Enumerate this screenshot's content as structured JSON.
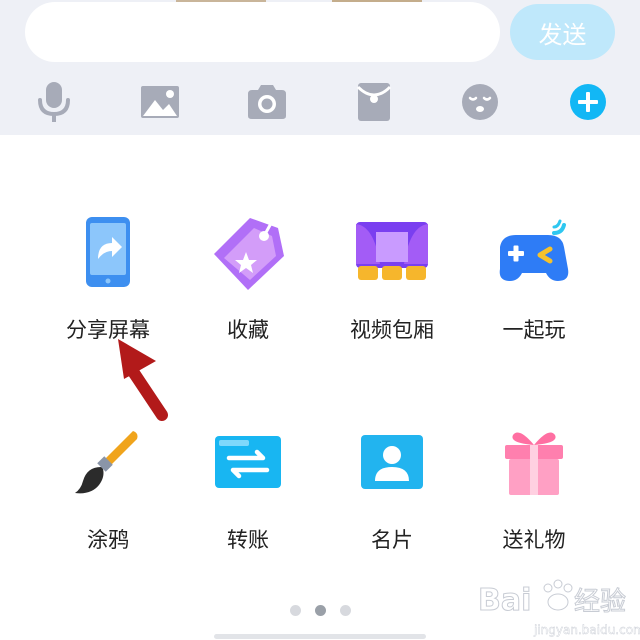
{
  "input": {
    "value": "",
    "placeholder": ""
  },
  "send_label": "发送",
  "toolbar_icons": [
    "microphone-icon",
    "image-icon",
    "camera-icon",
    "red-packet-icon",
    "emoji-icon",
    "plus-icon"
  ],
  "grid": [
    {
      "label": "分享屏幕",
      "icon": "share-screen-icon"
    },
    {
      "label": "收藏",
      "icon": "favorites-icon"
    },
    {
      "label": "视频包厢",
      "icon": "video-box-icon"
    },
    {
      "label": "一起玩",
      "icon": "gamepad-icon"
    },
    {
      "label": "涂鸦",
      "icon": "brush-icon"
    },
    {
      "label": "转账",
      "icon": "transfer-icon"
    },
    {
      "label": "名片",
      "icon": "business-card-icon"
    },
    {
      "label": "送礼物",
      "icon": "gift-icon"
    }
  ],
  "pager": {
    "pages": 3,
    "current": 2
  },
  "watermark": {
    "brand": "Bai",
    "brand_cn": "经验",
    "url": "jingyan.baidu.com"
  },
  "colors": {
    "accent": "#12b7f5",
    "send_disabled": "#bfe8fb",
    "toolbar_bg": "#eef0f6",
    "toolbar_icon": "#a7abb8"
  }
}
